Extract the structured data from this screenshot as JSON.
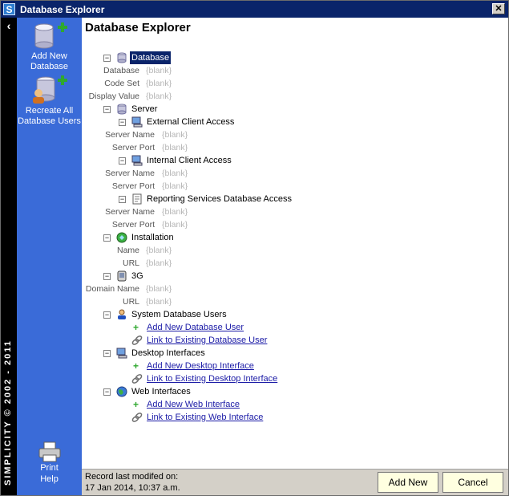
{
  "window": {
    "title": "Database Explorer",
    "logo_letter": "S",
    "close_glyph": "✕"
  },
  "brand": {
    "vertical_text": "SIMPLICITY © 2002 - 2011",
    "collapse_glyph": "‹"
  },
  "actions": {
    "add_new_database": "Add New Database",
    "recreate_all_users": "Recreate All Database Users",
    "print": "Print",
    "help": "Help"
  },
  "page": {
    "title": "Database Explorer"
  },
  "tree": {
    "database": {
      "label": "Database",
      "props": [
        {
          "label": "Database",
          "value": "{blank}"
        },
        {
          "label": "Code Set",
          "value": "{blank}"
        },
        {
          "label": "Display Value",
          "value": "{blank}"
        }
      ]
    },
    "server": {
      "label": "Server",
      "external": {
        "label": "External Client Access",
        "props": [
          {
            "label": "Server Name",
            "value": "{blank}"
          },
          {
            "label": "Server Port",
            "value": "{blank}"
          }
        ]
      },
      "internal": {
        "label": "Internal Client Access",
        "props": [
          {
            "label": "Server Name",
            "value": "{blank}"
          },
          {
            "label": "Server Port",
            "value": "{blank}"
          }
        ]
      },
      "reporting": {
        "label": "Reporting Services Database Access",
        "props": [
          {
            "label": "Server Name",
            "value": "{blank}"
          },
          {
            "label": "Server Port",
            "value": "{blank}"
          }
        ]
      }
    },
    "installation": {
      "label": "Installation",
      "props": [
        {
          "label": "Name",
          "value": "{blank}"
        },
        {
          "label": "URL",
          "value": "{blank}"
        }
      ]
    },
    "threeg": {
      "label": "3G",
      "props": [
        {
          "label": "Domain Name",
          "value": "{blank}"
        },
        {
          "label": "URL",
          "value": "{blank}"
        }
      ]
    },
    "system_users": {
      "label": "System Database Users",
      "add_link": "Add New Database User",
      "existing_link": "Link to Existing Database User"
    },
    "desktop": {
      "label": "Desktop Interfaces",
      "add_link": "Add New Desktop Interface",
      "existing_link": "Link to Existing Desktop Interface"
    },
    "web": {
      "label": "Web Interfaces",
      "add_link": "Add New Web Interface",
      "existing_link": "Link to Existing Web Interface"
    },
    "toggle_glyph": "−"
  },
  "footer": {
    "modified_label": "Record last modifed on:",
    "modified_value": "17 Jan 2014, 10:37 a.m.",
    "add_new_label": "Add New",
    "cancel_label": "Cancel"
  },
  "colors": {
    "title_bar": "#0a246a",
    "action_panel": "#3a6bd8",
    "link": "#1a1aa6",
    "blank_value": "#b5b5b5",
    "footer_button": "#ffffe0"
  }
}
